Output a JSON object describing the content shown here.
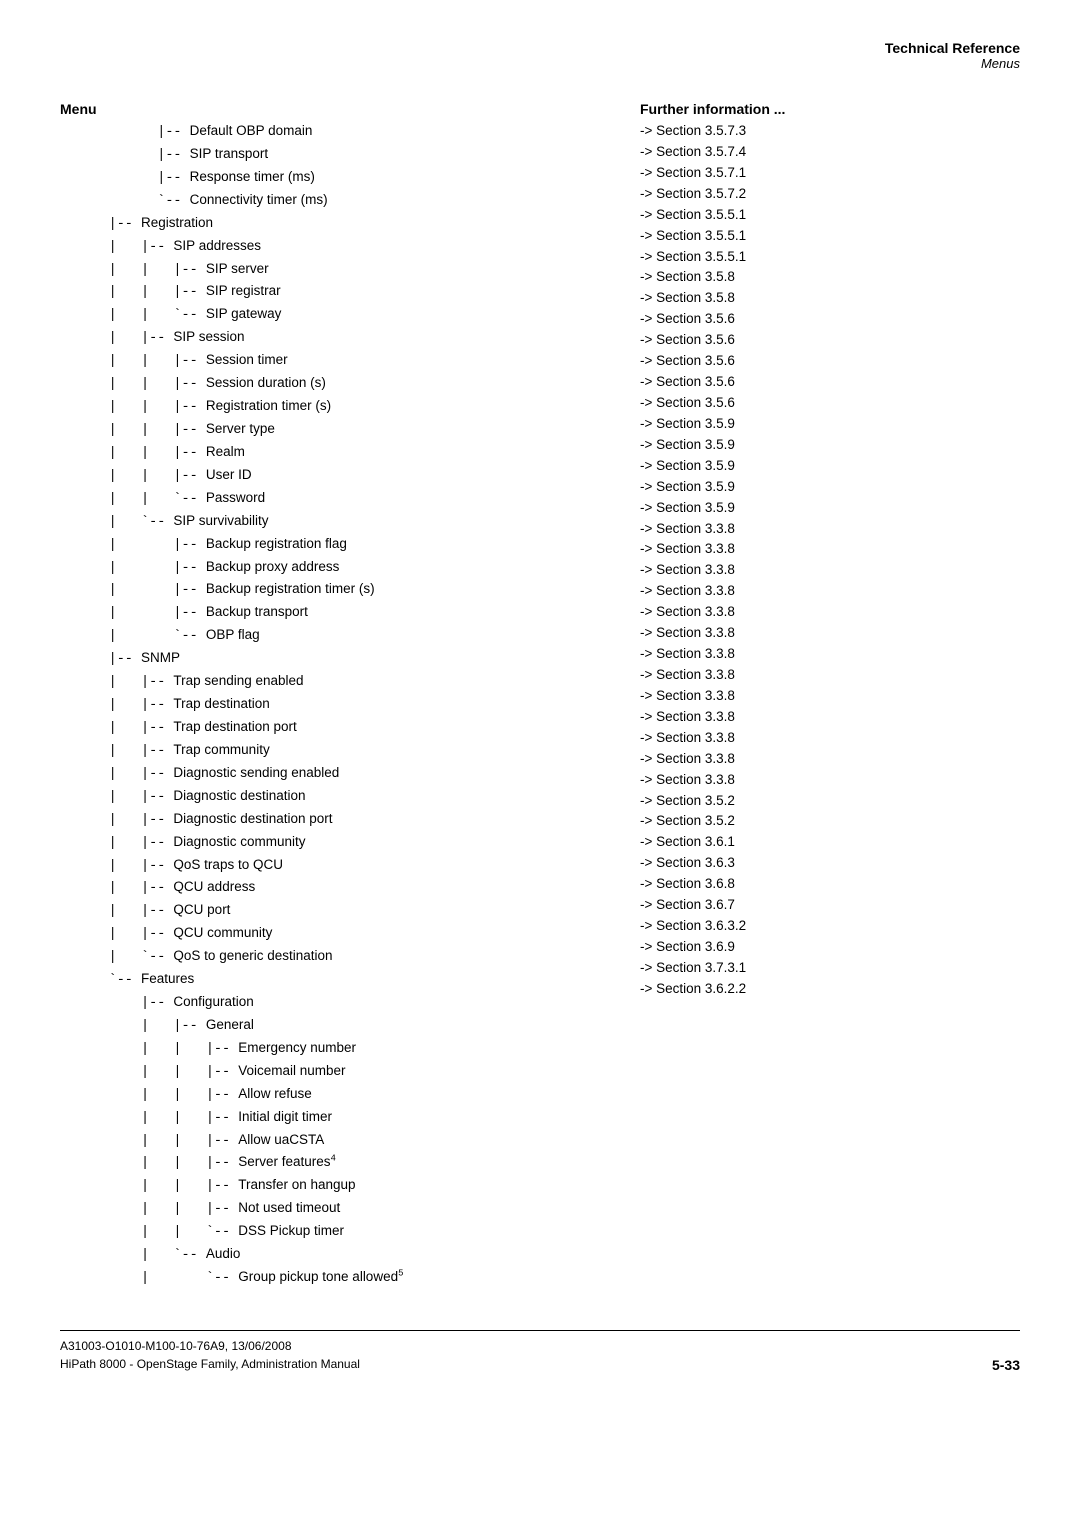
{
  "header": {
    "title": "Technical Reference",
    "subtitle": "Menus"
  },
  "menu_col_header": "Menu",
  "info_col_header": "Further information ...",
  "rows": [
    {
      "indent": "            |-- ",
      "label": "Default OBP domain",
      "section": "-> Section 3.5.7.3"
    },
    {
      "indent": "            |-- ",
      "label": "SIP transport",
      "section": "-> Section 3.5.7.4"
    },
    {
      "indent": "            |-- ",
      "label": "Response timer (ms)",
      "section": "-> Section 3.5.7.1"
    },
    {
      "indent": "            `-- ",
      "label": "Connectivity timer (ms)",
      "section": "-> Section 3.5.7.2"
    },
    {
      "indent": "      |-- ",
      "label": "Registration",
      "section": ""
    },
    {
      "indent": "      |   |-- ",
      "label": "SIP addresses",
      "section": ""
    },
    {
      "indent": "      |   |   |-- ",
      "label": "SIP server",
      "section": "-> Section 3.5.5.1"
    },
    {
      "indent": "      |   |   |-- ",
      "label": "SIP registrar",
      "section": "-> Section 3.5.5.1"
    },
    {
      "indent": "      |   |   `-- ",
      "label": "SIP gateway",
      "section": "-> Section 3.5.5.1"
    },
    {
      "indent": "      |   |-- ",
      "label": "SIP session",
      "section": ""
    },
    {
      "indent": "      |   |   |-- ",
      "label": "Session timer",
      "section": "-> Section 3.5.8"
    },
    {
      "indent": "      |   |   |-- ",
      "label": "Session duration (s)",
      "section": "-> Section 3.5.8"
    },
    {
      "indent": "      |   |   |-- ",
      "label": "Registration timer (s)",
      "section": "-> Section 3.5.6"
    },
    {
      "indent": "      |   |   |-- ",
      "label": "Server type",
      "section": "-> Section 3.5.6"
    },
    {
      "indent": "      |   |   |-- ",
      "label": "Realm",
      "section": "-> Section 3.5.6"
    },
    {
      "indent": "      |   |   |-- ",
      "label": "User ID",
      "section": "-> Section 3.5.6"
    },
    {
      "indent": "      |   |   `-- ",
      "label": "Password",
      "section": "-> Section 3.5.6"
    },
    {
      "indent": "      |   `-- ",
      "label": "SIP survivability",
      "section": ""
    },
    {
      "indent": "      |       |-- ",
      "label": "Backup registration flag",
      "section": "-> Section 3.5.9"
    },
    {
      "indent": "      |       |-- ",
      "label": "Backup proxy address",
      "section": "-> Section 3.5.9"
    },
    {
      "indent": "      |       |-- ",
      "label": "Backup registration timer (s)",
      "section": "-> Section 3.5.9"
    },
    {
      "indent": "      |       |-- ",
      "label": "Backup transport",
      "section": "-> Section 3.5.9"
    },
    {
      "indent": "      |       `-- ",
      "label": "OBP flag",
      "section": "-> Section 3.5.9"
    },
    {
      "indent": "      |-- ",
      "label": "SNMP",
      "section": ""
    },
    {
      "indent": "      |   |-- ",
      "label": "Trap sending enabled",
      "section": "-> Section 3.3.8"
    },
    {
      "indent": "      |   |-- ",
      "label": "Trap destination",
      "section": "-> Section 3.3.8"
    },
    {
      "indent": "      |   |-- ",
      "label": "Trap destination port",
      "section": "-> Section 3.3.8"
    },
    {
      "indent": "      |   |-- ",
      "label": "Trap community",
      "section": "-> Section 3.3.8"
    },
    {
      "indent": "      |   |-- ",
      "label": "Diagnostic sending enabled",
      "section": "-> Section 3.3.8"
    },
    {
      "indent": "      |   |-- ",
      "label": "Diagnostic destination",
      "section": "-> Section 3.3.8"
    },
    {
      "indent": "      |   |-- ",
      "label": "Diagnostic destination port",
      "section": "-> Section 3.3.8"
    },
    {
      "indent": "      |   |-- ",
      "label": "Diagnostic community",
      "section": "-> Section 3.3.8"
    },
    {
      "indent": "      |   |-- ",
      "label": "QoS traps to QCU",
      "section": "-> Section 3.3.8"
    },
    {
      "indent": "      |   |-- ",
      "label": "QCU address",
      "section": "-> Section 3.3.8"
    },
    {
      "indent": "      |   |-- ",
      "label": "QCU port",
      "section": "-> Section 3.3.8"
    },
    {
      "indent": "      |   |-- ",
      "label": "QCU community",
      "section": "-> Section 3.3.8"
    },
    {
      "indent": "      |   `-- ",
      "label": "QoS to generic destination",
      "section": "-> Section 3.3.8"
    },
    {
      "indent": "      `-- ",
      "label": "Features",
      "section": ""
    },
    {
      "indent": "          |-- ",
      "label": "Configuration",
      "section": ""
    },
    {
      "indent": "          |   |-- ",
      "label": "General",
      "section": ""
    },
    {
      "indent": "          |   |   |-- ",
      "label": "Emergency number",
      "section": "-> Section 3.5.2"
    },
    {
      "indent": "          |   |   |-- ",
      "label": "Voicemail number",
      "section": "-> Section 3.5.2"
    },
    {
      "indent": "          |   |   |-- ",
      "label": "Allow refuse",
      "section": "-> Section 3.6.1"
    },
    {
      "indent": "          |   |   |-- ",
      "label": "Initial digit timer",
      "section": "-> Section 3.6.3"
    },
    {
      "indent": "          |   |   |-- ",
      "label": "Allow uaCSTA",
      "section": "-> Section 3.6.8"
    },
    {
      "indent": "          |   |   |-- ",
      "label": "Server features",
      "sup": "4",
      "section": "-> Section 3.6.7"
    },
    {
      "indent": "          |   |   |-- ",
      "label": "Transfer on hangup",
      "section": "-> Section 3.6.3.2"
    },
    {
      "indent": "          |   |   |-- ",
      "label": "Not used timeout",
      "section": "-> Section 3.6.9"
    },
    {
      "indent": "          |   |   `-- ",
      "label": "DSS Pickup timer",
      "section": "-> Section 3.7.3.1"
    },
    {
      "indent": "          |   `-- ",
      "label": "Audio",
      "section": ""
    },
    {
      "indent": "          |       `-- ",
      "label": "Group pickup tone allowed",
      "sup": "5",
      "section": "-> Section 3.6.2.2"
    }
  ],
  "footer": {
    "doc_id": "A31003-O1010-M100-10-76A9, 13/06/2008",
    "doc_name": "HiPath 8000 - OpenStage Family, Administration Manual",
    "page": "5-33"
  }
}
